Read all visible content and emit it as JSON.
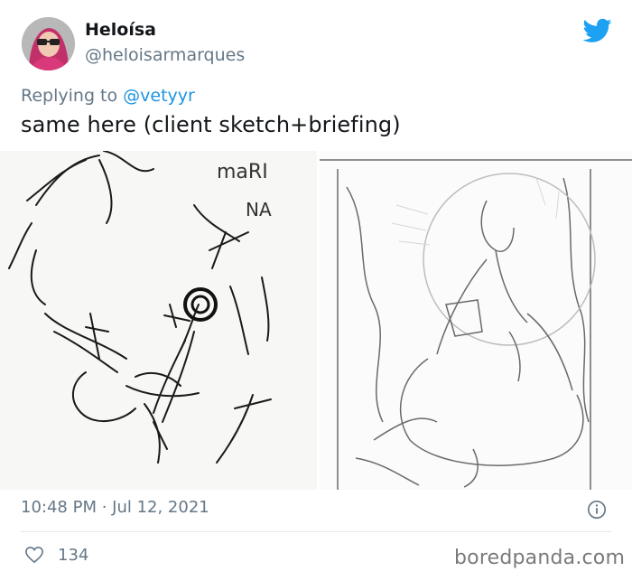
{
  "tweet": {
    "display_name": "Heloísa",
    "handle": "@heloisarmarques",
    "reply_prefix": "Replying to",
    "reply_handle": "@vetyyr",
    "text": "same here (client sketch+briefing)",
    "timestamp": "10:48 PM · Jul 12, 2021",
    "like_count": "134"
  },
  "media": {
    "left_sketch_text_1": "maRI",
    "left_sketch_text_2": "NA"
  },
  "footer": {
    "watermark": "boredpanda.com"
  },
  "colors": {
    "brand_blue": "#1da1f2",
    "secondary_text": "#657786",
    "mention_blue": "#1b95e0"
  },
  "icons": [
    "twitter-bird-icon",
    "info-icon",
    "heart-icon"
  ]
}
